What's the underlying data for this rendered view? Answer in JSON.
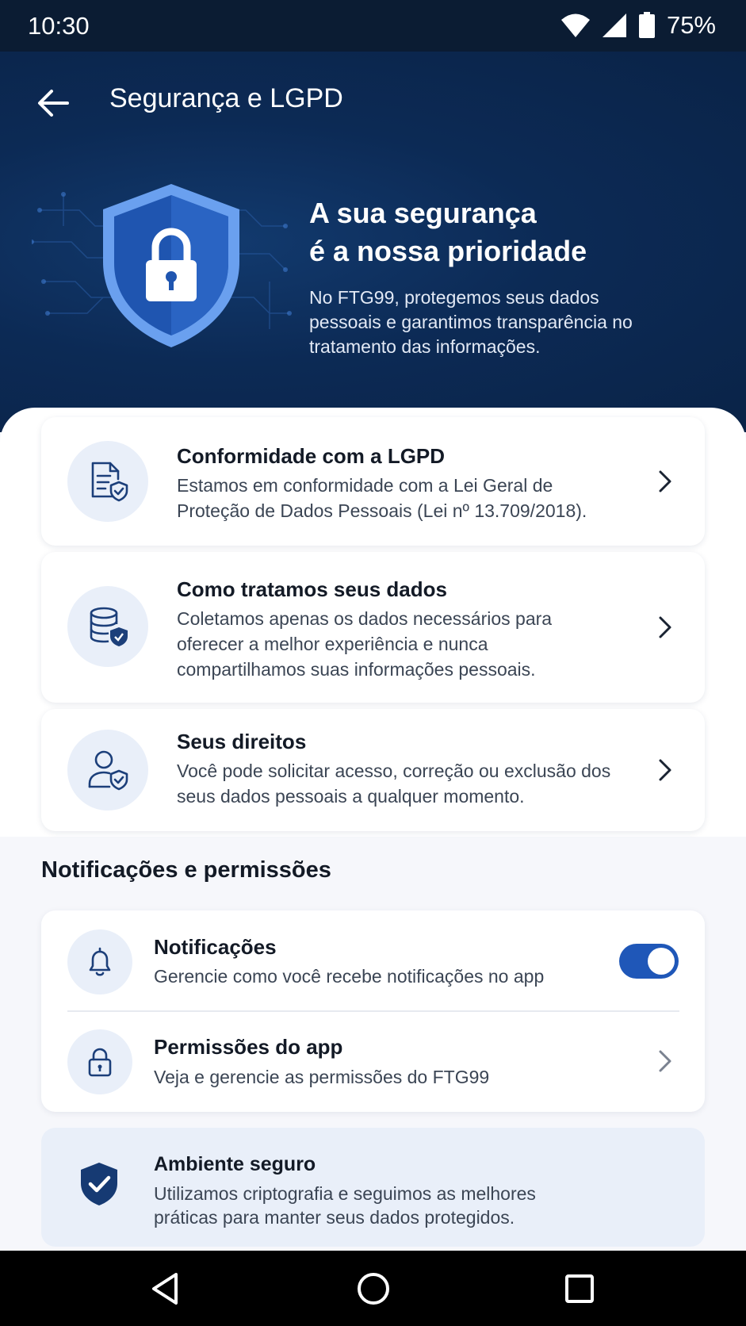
{
  "status_bar": {
    "time": "10:30",
    "battery_percent": "75%"
  },
  "header": {
    "title": "Segurança e LGPD"
  },
  "hero": {
    "heading_line1": "A sua segurança",
    "heading_line2": "é a nossa prioridade",
    "description": "No FTG99, protegemos seus dados pessoais e garantimos transparência no tratamento das informações."
  },
  "cards": [
    {
      "title": "Conformidade com a LGPD",
      "description": "Estamos em conformidade com a Lei Geral de Proteção de Dados Pessoais (Lei nº 13.709/2018).",
      "icon": "document-shield-icon"
    },
    {
      "title": "Como tratamos seus dados",
      "description": "Coletamos apenas os dados necessários para oferecer a melhor experiência e nunca compartilhamos suas informações pessoais.",
      "icon": "database-shield-icon"
    },
    {
      "title": "Seus direitos",
      "description": "Você pode solicitar acesso, correção ou exclusão dos seus dados pessoais a qualquer momento.",
      "icon": "user-shield-icon"
    }
  ],
  "permissions_section": {
    "title": "Notificações e permissões",
    "notifications": {
      "title": "Notificações",
      "description": "Gerencie como você recebe notificações no app",
      "enabled": true
    },
    "app_permissions": {
      "title": "Permissões do app",
      "description": "Veja e gerencie as permissões do FTG99"
    }
  },
  "secure_environment": {
    "title": "Ambiente seguro",
    "description": "Utilizamos criptografia e seguimos as melhores práticas para manter seus dados protegidos."
  },
  "colors": {
    "header_bg": "#0c2a55",
    "accent": "#1f57b8",
    "icon_bg": "#e9eff9",
    "icon_stroke": "#1c3f7a"
  }
}
